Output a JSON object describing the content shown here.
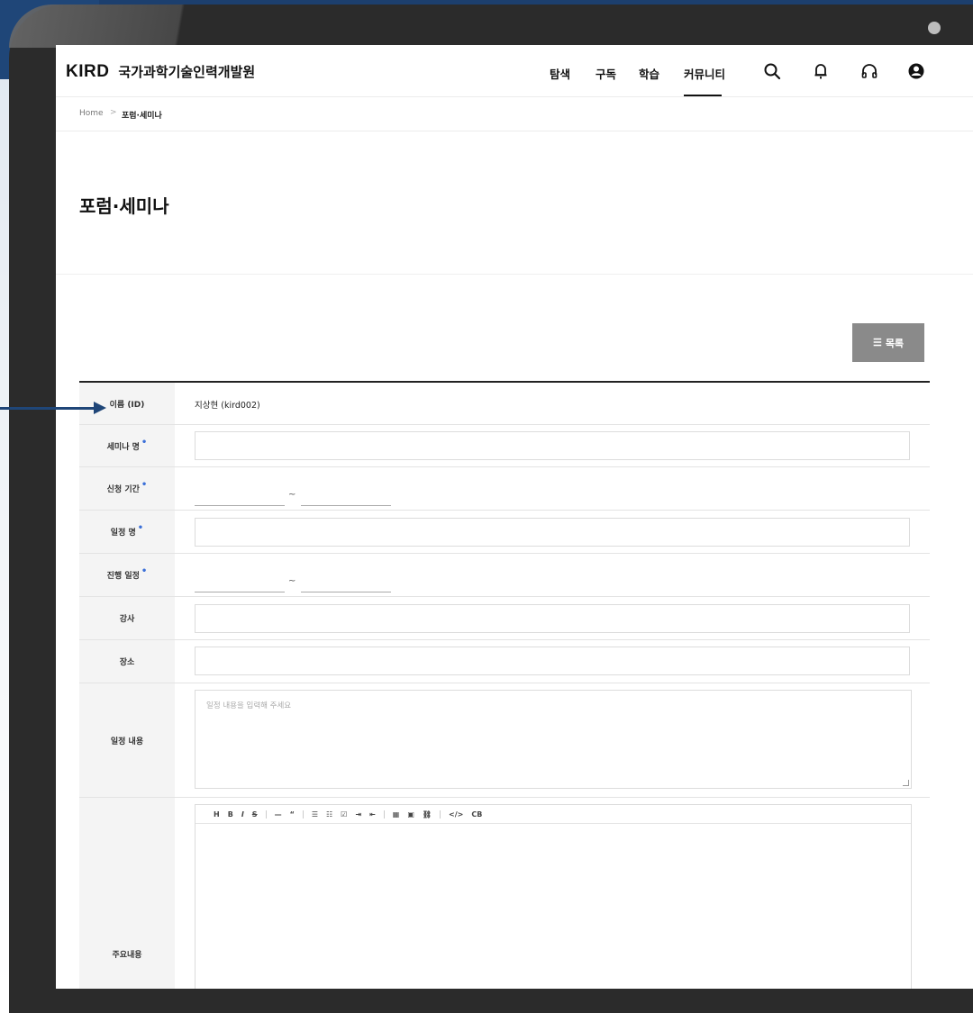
{
  "header": {
    "logo_short": "KIRD",
    "logo_name": "국가과학기술인력개발원",
    "nav": [
      {
        "label": "탐색"
      },
      {
        "label": "구독"
      },
      {
        "label": "학습"
      },
      {
        "label": "커뮤니티",
        "active": true
      }
    ],
    "icons": [
      "search-icon",
      "bell-icon",
      "headphones-icon",
      "user-icon"
    ]
  },
  "breadcrumb": {
    "home": "Home",
    "separator": ">",
    "current": "포럼·세미나"
  },
  "page_title": "포럼·세미나",
  "list_button": {
    "icon": "list-icon",
    "label": "목록"
  },
  "form": {
    "name_id": {
      "label": "이름 (ID)",
      "value": "지상현 (kird002)"
    },
    "seminar_name": {
      "label": "세미나 명",
      "required": "•"
    },
    "apply_period": {
      "label": "신청 기간",
      "required": "•",
      "tilde": "~"
    },
    "schedule_name": {
      "label": "일정 명",
      "required": "•"
    },
    "progress_schedule": {
      "label": "진행 일정",
      "required": "•",
      "tilde": "~"
    },
    "instructor": {
      "label": "강사"
    },
    "place": {
      "label": "장소"
    },
    "schedule_content": {
      "label": "일정 내용",
      "placeholder": "일정 내용을 입력해 주세요"
    },
    "main_content": {
      "label": "주요내용",
      "toolbar": [
        "H",
        "B",
        "I",
        "S",
        "—",
        "“",
        "☰",
        "☷",
        "☑",
        "⇥",
        "⇤",
        "▦",
        "▣",
        "⛓",
        "</>",
        "CB"
      ]
    }
  },
  "colors": {
    "accent_blue": "#1f4678",
    "required_dot": "#3a6fd8",
    "list_button_bg": "#8a8a8a"
  }
}
